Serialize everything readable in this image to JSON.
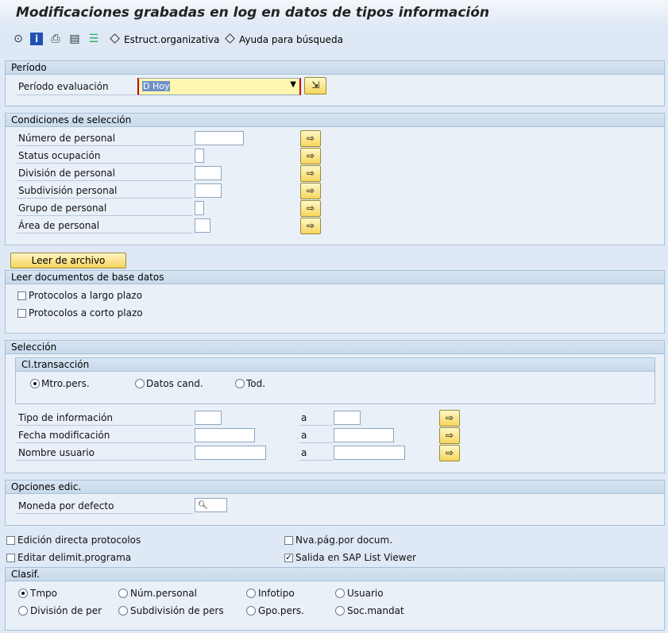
{
  "title": "Modificaciones grabadas en log en datos de tipos información",
  "toolbar": {
    "icons": [
      "execute-icon",
      "info-icon",
      "print-icon",
      "variant-icon",
      "selection-icon"
    ],
    "estruct_label": "Estruct.organizativa",
    "ayuda_label": "Ayuda para búsqueda"
  },
  "periodo": {
    "header": "Período",
    "label": "Período evaluación",
    "value": "D Hoy"
  },
  "condiciones": {
    "header": "Condiciones de selección",
    "fields": [
      {
        "label": "Número de personal"
      },
      {
        "label": "Status ocupación"
      },
      {
        "label": "División de personal"
      },
      {
        "label": "Subdivisión personal"
      },
      {
        "label": "Grupo de personal"
      },
      {
        "label": "Área de personal"
      }
    ]
  },
  "leer_archivo_button": "Leer de archivo",
  "leer_documentos": {
    "header": "Leer documentos de base datos",
    "largo_plazo": "Protocolos a largo plazo",
    "corto_plazo": "Protocolos a corto plazo"
  },
  "seleccion": {
    "header": "Selección",
    "cl_transaccion": {
      "header": "Cl.transacción",
      "options": [
        "Mtro.pers.",
        "Datos cand.",
        "Tod."
      ],
      "selected": "Mtro.pers."
    },
    "rows": [
      {
        "label": "Tipo de información",
        "to": "a"
      },
      {
        "label": "Fecha modificación",
        "to": "a"
      },
      {
        "label": "Nombre usuario",
        "to": "a"
      }
    ]
  },
  "opciones": {
    "header": "Opciones edic.",
    "moneda_label": "Moneda por defecto"
  },
  "checks": {
    "edicion_directa": {
      "label": "Edición directa protocolos",
      "checked": false
    },
    "nva_pag": {
      "label": "Nva.pág.por docum.",
      "checked": false
    },
    "editar_delimit": {
      "label": "Editar delimit.programa",
      "checked": false
    },
    "salida_alv": {
      "label": "Salida en SAP List Viewer",
      "checked": true
    }
  },
  "clasif": {
    "header": "Clasif.",
    "options": [
      "Tmpo",
      "Núm.personal",
      "Infotipo",
      "Usuario",
      "División de per",
      "Subdivisión de pers",
      "Gpo.pers.",
      "Soc.mandat"
    ],
    "selected": "Tmpo"
  },
  "colors": {
    "accent": "#f6d35b",
    "panel": "#e9f0f8",
    "background": "#dfe9f5"
  }
}
